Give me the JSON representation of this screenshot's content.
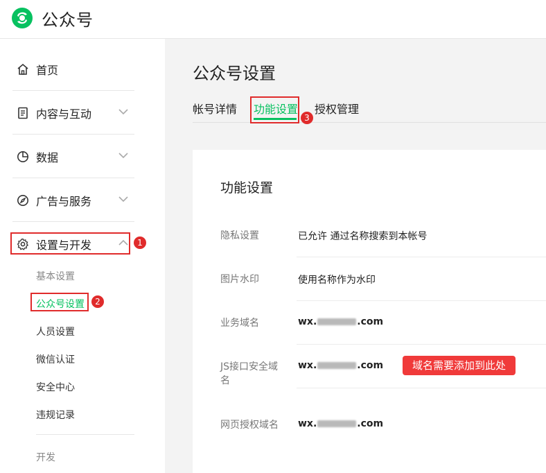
{
  "header": {
    "app_title": "公众号"
  },
  "sidebar": {
    "items": [
      {
        "label": "首页",
        "icon": "home-icon"
      },
      {
        "label": "内容与互动",
        "icon": "document-icon"
      },
      {
        "label": "数据",
        "icon": "pie-chart-icon"
      },
      {
        "label": "广告与服务",
        "icon": "compass-icon"
      },
      {
        "label": "设置与开发",
        "icon": "gear-icon"
      }
    ],
    "sub_items": [
      "基本设置",
      "公众号设置",
      "人员设置",
      "微信认证",
      "安全中心",
      "违规记录"
    ],
    "dev_label": "开发"
  },
  "annotations": {
    "badge1": "1",
    "badge2": "2",
    "badge3": "3"
  },
  "main": {
    "page_title": "公众号设置",
    "tabs": [
      "帐号详情",
      "功能设置",
      "授权管理"
    ],
    "card_title": "功能设置",
    "rows": [
      {
        "label": "隐私设置",
        "value": "已允许 通过名称搜索到本帐号"
      },
      {
        "label": "图片水印",
        "value": "使用名称作为水印"
      },
      {
        "label": "业务域名",
        "value_prefix": "wx.",
        "value_suffix": ".com"
      },
      {
        "label": "JS接口安全域名",
        "value_prefix": "wx.",
        "value_suffix": ".com"
      },
      {
        "label": "网页授权域名",
        "value_prefix": "wx.",
        "value_suffix": ".com"
      }
    ],
    "callout": "域名需要添加到此处"
  },
  "colors": {
    "accent": "#07c160",
    "annotation_red": "#e02b2b"
  }
}
